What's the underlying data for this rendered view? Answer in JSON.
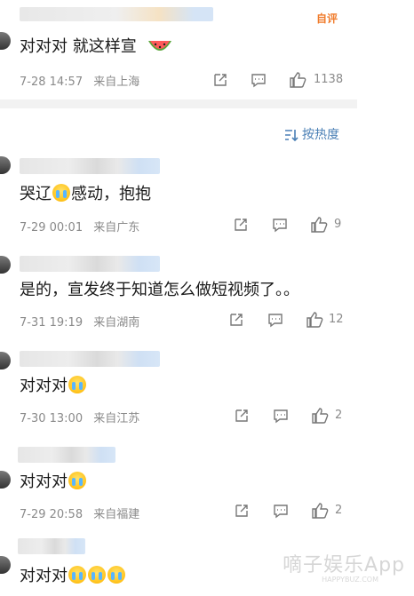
{
  "top_comment": {
    "text": "对对对 就这样宣",
    "emoji_icon": "watermelon-icon",
    "time": "7-28 14:57",
    "location": "来自上海",
    "likes": "1138",
    "badge": "自评"
  },
  "sort_label": "按热度",
  "comments": [
    {
      "text_before": "哭辽",
      "emojis_inline": 1,
      "text_after": "感动，抱抱",
      "time": "7-29 00:01",
      "location": "来自广东",
      "likes": "9"
    },
    {
      "text_before": "是的，宣发终于知道怎么做短视频了。。",
      "emojis_inline": 0,
      "text_after": "",
      "time": "7-31 19:19",
      "location": "来自湖南",
      "likes": "12"
    },
    {
      "text_before": "对对对",
      "emojis_inline": 1,
      "text_after": "",
      "time": "7-30 13:00",
      "location": "来自江苏",
      "likes": "2"
    },
    {
      "text_before": "对对对",
      "emojis_inline": 1,
      "text_after": "",
      "time": "7-29 20:58",
      "location": "来自福建",
      "likes": "2"
    },
    {
      "text_before": "对对对",
      "emojis_inline": 3,
      "text_after": "",
      "time": "",
      "location": "",
      "likes": ""
    }
  ],
  "watermark": {
    "main": "嘀子娱乐App",
    "sub": "HAPPYBUZ.COM"
  },
  "colors": {
    "link": "#4a7fb5",
    "meta": "#8a8a8a",
    "badge": "#f07c2c"
  }
}
